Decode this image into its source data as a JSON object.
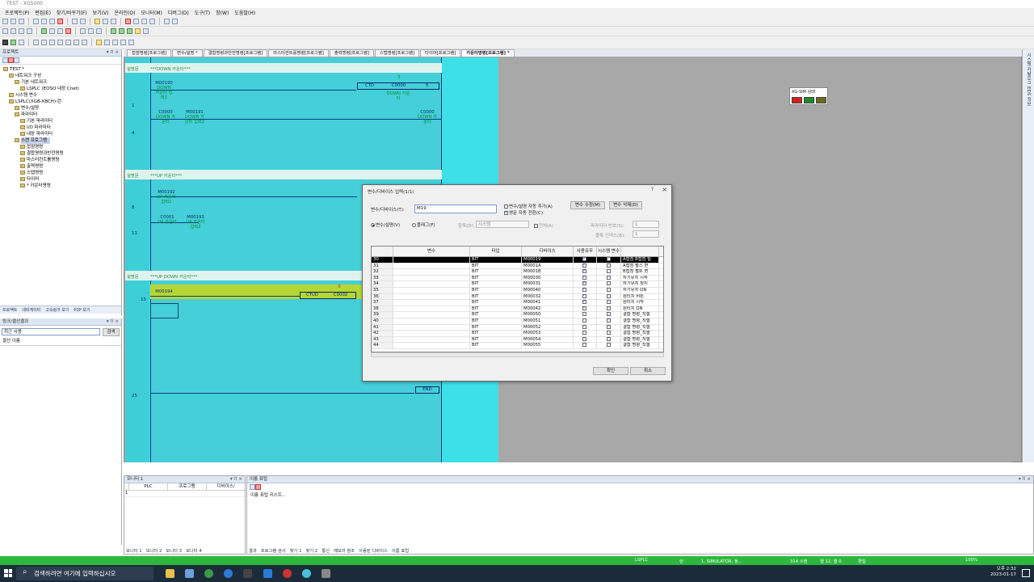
{
  "window": {
    "title": "TEST - XG5000"
  },
  "menu": [
    "프로젝트(P)",
    "편집(E)",
    "찾기/바꾸기(F)",
    "보기(V)",
    "온라인(O)",
    "모니터(M)",
    "디버그(D)",
    "도구(T)",
    "창(W)",
    "도움말(H)"
  ],
  "project_panel": {
    "header": "프로젝트",
    "tree": [
      {
        "label": "TEST *",
        "indent": 0
      },
      {
        "label": "네트워크 구성",
        "indent": 1
      },
      {
        "label": "기본 네트워크",
        "indent": 2
      },
      {
        "label": "LSPLC (EOSO 내장 Cnet)",
        "indent": 3
      },
      {
        "label": "시스템 변수",
        "indent": 1
      },
      {
        "label": "LSPLC(XGB-XBCH)-런",
        "indent": 1
      },
      {
        "label": "변수/설명",
        "indent": 2
      },
      {
        "label": "파라미터",
        "indent": 2
      },
      {
        "label": "기본 파라미터",
        "indent": 3
      },
      {
        "label": "I/O 파라미터",
        "indent": 3
      },
      {
        "label": "내장 파라미터",
        "indent": 3
      },
      {
        "label": "스캔 프로그램",
        "indent": 2,
        "selected": true
      },
      {
        "label": "접점명령",
        "indent": 3
      },
      {
        "label": "결합명령과반전명령",
        "indent": 3
      },
      {
        "label": "마스터컨트롤명령",
        "indent": 3
      },
      {
        "label": "출력명령",
        "indent": 3
      },
      {
        "label": "스텝명령",
        "indent": 3
      },
      {
        "label": "타이머",
        "indent": 3
      },
      {
        "label": "* 카운터명령",
        "indent": 3
      }
    ],
    "tabs": [
      "프로젝트",
      "네비게이터",
      "고속링크 보기",
      "P2P 보기"
    ]
  },
  "history_panel": {
    "header": "링크/결선결과",
    "select": "최근 사용",
    "button": "검색",
    "column": "결선 이름"
  },
  "editor_tabs": [
    "접점명령[프로그램]",
    "변수/설명 *",
    "결합명령과반전명령[프로그램]",
    "마스터컨트롤명령[프로그램]",
    "출력명령[프로그램]",
    "스텝명령[프로그램]",
    "타이머[프로그램]",
    "카운터명령[프로그램] *"
  ],
  "ladder": {
    "sections": [
      {
        "tag": "설명문",
        "comment": "***DOWN 카운터***"
      },
      {
        "tag": "설명문",
        "comment": "***UP 카운터***"
      },
      {
        "tag": "설명문",
        "comment": "***UP DOWN 카운터***"
      }
    ],
    "rungs": [
      "1",
      "4",
      "8",
      "11",
      "15",
      "25"
    ],
    "elements": {
      "m00190": "M00190",
      "m00190_c": "DOWN 카운터 입력1",
      "ctd": "CTD",
      "c0000": "C0000",
      "ctd_val": "5",
      "ctd_preset": "5",
      "ctd_c": "DOWN 카운터",
      "c0000_a": "C0000",
      "c0000_ac": "DOWN 카운터",
      "m00191": "M00191",
      "m00191_c": "DOWN 카운터 입력2",
      "c0000_out": "C0000",
      "c0000_outc": "DOWN 카운터",
      "m00192": "M00192",
      "m00192_c": "UP 카운터 입력1",
      "c0001": "C0001",
      "c0001_c": "UP 카운터",
      "m00193": "M00193",
      "m00193_c": "UP 카운터 입력2",
      "m00194": "M00194",
      "ctud": "CTUD",
      "c0002": "C0002",
      "ctud_val": "0",
      "end": "END"
    }
  },
  "sim_window": {
    "title": "XG-SIM 상태",
    "lamps": [
      "#d81e1e",
      "#1a8a2a",
      "#6a6a1a"
    ]
  },
  "right_strip": "시스템 카탈로그 EDS 정보",
  "dialog": {
    "title": "변수/디바이스 입력(1/1)",
    "device_label": "변수/디바이스(T):",
    "device_value": "M19",
    "auto_add": "변수/설명 자동 추가(A)",
    "auto_convert": "영문 자동 전환(C)",
    "btn_modify": "변수 수정(M)",
    "btn_delete": "변수 삭제(D)",
    "radio_var": "변수/설명(V)",
    "radio_flag": "플래그(F)",
    "item_label": "항목(D):",
    "item_value": "시스템",
    "all_label": "전체(A)",
    "param_no_label": "파라미터 번호(S):",
    "param_no_value": "1",
    "block_index_label": "블록 인덱스(B):",
    "block_index_value": "1",
    "columns": [
      "",
      "변수",
      "타입",
      "디바이스",
      "사용유무",
      "시스템 변수",
      ""
    ],
    "rows": [
      {
        "no": "30",
        "var": "",
        "type": "BIT",
        "dev": "M00019",
        "used": true,
        "sys": false,
        "desc": "A접점 B접점 빌",
        "sel": true
      },
      {
        "no": "31",
        "var": "",
        "type": "BIT",
        "dev": "M0001A",
        "used": true,
        "sys": false,
        "desc": "A접점 펄스 변"
      },
      {
        "no": "32",
        "var": "",
        "type": "BIT",
        "dev": "M0001B",
        "used": true,
        "sys": false,
        "desc": "B접점 펄트 변"
      },
      {
        "no": "33",
        "var": "",
        "type": "BIT",
        "dev": "M00030",
        "used": true,
        "sys": false,
        "desc": "자기유지 시작"
      },
      {
        "no": "34",
        "var": "",
        "type": "BIT",
        "dev": "M00031",
        "used": true,
        "sys": false,
        "desc": "자기유지 정지"
      },
      {
        "no": "35",
        "var": "",
        "type": "BIT",
        "dev": "M00040",
        "used": true,
        "sys": false,
        "desc": "자기유지 ON"
      },
      {
        "no": "36",
        "var": "",
        "type": "BIT",
        "dev": "M00032",
        "used": true,
        "sys": false,
        "desc": "원터치 버튼"
      },
      {
        "no": "37",
        "var": "",
        "type": "BIT",
        "dev": "M00041",
        "used": true,
        "sys": false,
        "desc": "원터치 시작"
      },
      {
        "no": "38",
        "var": "",
        "type": "BIT",
        "dev": "M00042",
        "used": true,
        "sys": false,
        "desc": "원터치 ON"
      },
      {
        "no": "39",
        "var": "",
        "type": "BIT",
        "dev": "M00050",
        "used": false,
        "sys": false,
        "desc": "결합 명령_직렬"
      },
      {
        "no": "40",
        "var": "",
        "type": "BIT",
        "dev": "M00051",
        "used": false,
        "sys": false,
        "desc": "결합 명령_직렬"
      },
      {
        "no": "41",
        "var": "",
        "type": "BIT",
        "dev": "M00052",
        "used": false,
        "sys": false,
        "desc": "결합 명령_직렬"
      },
      {
        "no": "42",
        "var": "",
        "type": "BIT",
        "dev": "M00053",
        "used": false,
        "sys": false,
        "desc": "결합 명령_직렬"
      },
      {
        "no": "43",
        "var": "",
        "type": "BIT",
        "dev": "M00054",
        "used": false,
        "sys": false,
        "desc": "결합 명령_직렬"
      },
      {
        "no": "44",
        "var": "",
        "type": "BIT",
        "dev": "M00055",
        "used": false,
        "sys": false,
        "desc": "결합 명령_직렬"
      }
    ],
    "ok": "확인",
    "cancel": "취소"
  },
  "monitor_panel": {
    "header": "모니터 1",
    "columns": [
      "PLC",
      "프로그램",
      "디바이스/"
    ],
    "row1": "1",
    "tabs": [
      "모니터 1",
      "모니터 2",
      "모니터 3",
      "모니터 4"
    ]
  },
  "output_panel": {
    "header": "이름 표텁",
    "content": "이름 표텁 리스트...",
    "tabs": [
      "결과",
      "프로그램 검사",
      "찾기 1",
      "찾기 2",
      "통신",
      "메모리 참조",
      "사용된 디바이스",
      "이름 표텁"
    ]
  },
  "statusbar": {
    "plc": "LSPLC",
    "mode": "런",
    "sim": "1, SIMULATOR, 정...",
    "scan": "314 스캔",
    "pos": "행 12, 열 0",
    "edit": "편집",
    "zoom": "100%"
  },
  "taskbar": {
    "search_placeholder": "검색하려면 여기에 입력하십시오",
    "time": "오후 2:32",
    "date": "2023-01-17"
  }
}
